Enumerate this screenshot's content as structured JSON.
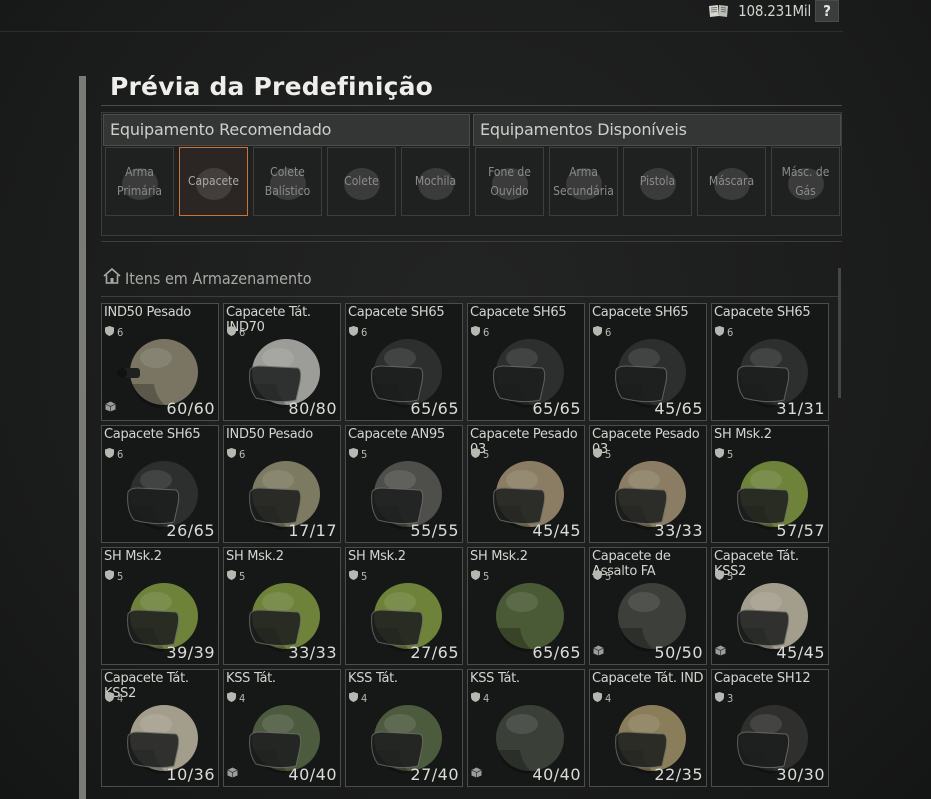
{
  "header": {
    "money_value": "108.231Mil",
    "help_label": "?",
    "money_icon": "book-icon"
  },
  "preset": {
    "title": "Prévia da Predefinição",
    "recommended_label": "Equipamento Recomendado",
    "available_label": "Equipamentos Disponíveis",
    "slots": [
      {
        "label": "Arma Primária",
        "icon": "rifle-icon",
        "active": false
      },
      {
        "label": "Capacete",
        "icon": "helmet-icon",
        "active": true
      },
      {
        "label": "Colete Balístico",
        "icon": "vest-icon",
        "active": false
      },
      {
        "label": "Colete",
        "icon": "rig-icon",
        "active": false
      },
      {
        "label": "Mochila",
        "icon": "backpack-icon",
        "active": false
      },
      {
        "label": "Fone de Ouvido",
        "icon": "headset-icon",
        "active": false
      },
      {
        "label": "Arma Secundária",
        "icon": "rifle-icon",
        "active": false
      },
      {
        "label": "Pistola",
        "icon": "pistol-icon",
        "active": false
      },
      {
        "label": "Máscara",
        "icon": "mask-icon",
        "active": false
      },
      {
        "label": "Másc. de Gás",
        "icon": "gasmask-icon",
        "active": false
      }
    ]
  },
  "storage": {
    "title": "Itens em Armazenamento",
    "icon": "home-icon",
    "items": [
      {
        "name": "IND50 Pesado",
        "armor": "6",
        "durability": "60/60",
        "color": "#7a7562",
        "visor": false,
        "nvg": true,
        "box": true
      },
      {
        "name": "Capacete Tát. IND70",
        "armor": "6",
        "durability": "80/80",
        "color": "#9c9c98",
        "visor": true,
        "nvg": false,
        "box": false
      },
      {
        "name": "Capacete SH65",
        "armor": "6",
        "durability": "65/65",
        "color": "#2d2e2e",
        "visor": true,
        "nvg": false,
        "box": false
      },
      {
        "name": "Capacete SH65",
        "armor": "6",
        "durability": "65/65",
        "color": "#2d2e2e",
        "visor": true,
        "nvg": false,
        "box": false
      },
      {
        "name": "Capacete SH65",
        "armor": "6",
        "durability": "45/65",
        "color": "#2d2e2e",
        "visor": true,
        "nvg": false,
        "box": false
      },
      {
        "name": "Capacete SH65",
        "armor": "6",
        "durability": "31/31",
        "color": "#2d2e2e",
        "visor": true,
        "nvg": false,
        "box": false
      },
      {
        "name": "Capacete SH65",
        "armor": "6",
        "durability": "26/65",
        "color": "#2d2e2e",
        "visor": true,
        "nvg": false,
        "box": false
      },
      {
        "name": "IND50 Pesado",
        "armor": "6",
        "durability": "17/17",
        "color": "#7c7a60",
        "visor": true,
        "nvg": false,
        "box": false
      },
      {
        "name": "Capacete AN95",
        "armor": "5",
        "durability": "55/55",
        "color": "#4e4f4a",
        "visor": true,
        "nvg": false,
        "box": false
      },
      {
        "name": "Capacete Pesado 03",
        "armor": "5",
        "durability": "45/45",
        "color": "#8a7d63",
        "visor": true,
        "nvg": false,
        "box": false
      },
      {
        "name": "Capacete Pesado 03",
        "armor": "5",
        "durability": "33/33",
        "color": "#8a7d63",
        "visor": true,
        "nvg": false,
        "box": false
      },
      {
        "name": "SH Msk.2",
        "armor": "5",
        "durability": "57/57",
        "color": "#6e8239",
        "visor": true,
        "nvg": false,
        "box": false
      },
      {
        "name": "SH Msk.2",
        "armor": "5",
        "durability": "39/39",
        "color": "#6e8239",
        "visor": true,
        "nvg": false,
        "box": false
      },
      {
        "name": "SH Msk.2",
        "armor": "5",
        "durability": "33/33",
        "color": "#6e8239",
        "visor": true,
        "nvg": false,
        "box": false
      },
      {
        "name": "SH Msk.2",
        "armor": "5",
        "durability": "27/65",
        "color": "#6e8239",
        "visor": true,
        "nvg": false,
        "box": false
      },
      {
        "name": "SH Msk.2",
        "armor": "5",
        "durability": "65/65",
        "color": "#4b5a36",
        "visor": false,
        "nvg": false,
        "box": false
      },
      {
        "name": "Capacete de Assalto FA",
        "armor": "5",
        "durability": "50/50",
        "color": "#3d3f3a",
        "visor": false,
        "nvg": false,
        "box": true
      },
      {
        "name": "Capacete Tát. KSS2",
        "armor": "5",
        "durability": "45/45",
        "color": "#a39e8c",
        "visor": true,
        "nvg": false,
        "box": true
      },
      {
        "name": "Capacete Tát. KSS2",
        "armor": "4",
        "durability": "10/36",
        "color": "#a39e8c",
        "visor": true,
        "nvg": false,
        "box": false
      },
      {
        "name": "KSS Tát.",
        "armor": "4",
        "durability": "40/40",
        "color": "#4c5a3e",
        "visor": true,
        "nvg": false,
        "box": true
      },
      {
        "name": "KSS Tát.",
        "armor": "4",
        "durability": "27/40",
        "color": "#4c5a3e",
        "visor": true,
        "nvg": false,
        "box": false
      },
      {
        "name": "KSS Tát.",
        "armor": "4",
        "durability": "40/40",
        "color": "#3a3f38",
        "visor": false,
        "nvg": false,
        "box": true
      },
      {
        "name": "Capacete Tát. IND",
        "armor": "4",
        "durability": "22/35",
        "color": "#8a7d5a",
        "visor": true,
        "nvg": false,
        "box": false
      },
      {
        "name": "Capacete SH12",
        "armor": "3",
        "durability": "30/30",
        "color": "#2f302d",
        "visor": true,
        "nvg": false,
        "box": false
      }
    ]
  }
}
